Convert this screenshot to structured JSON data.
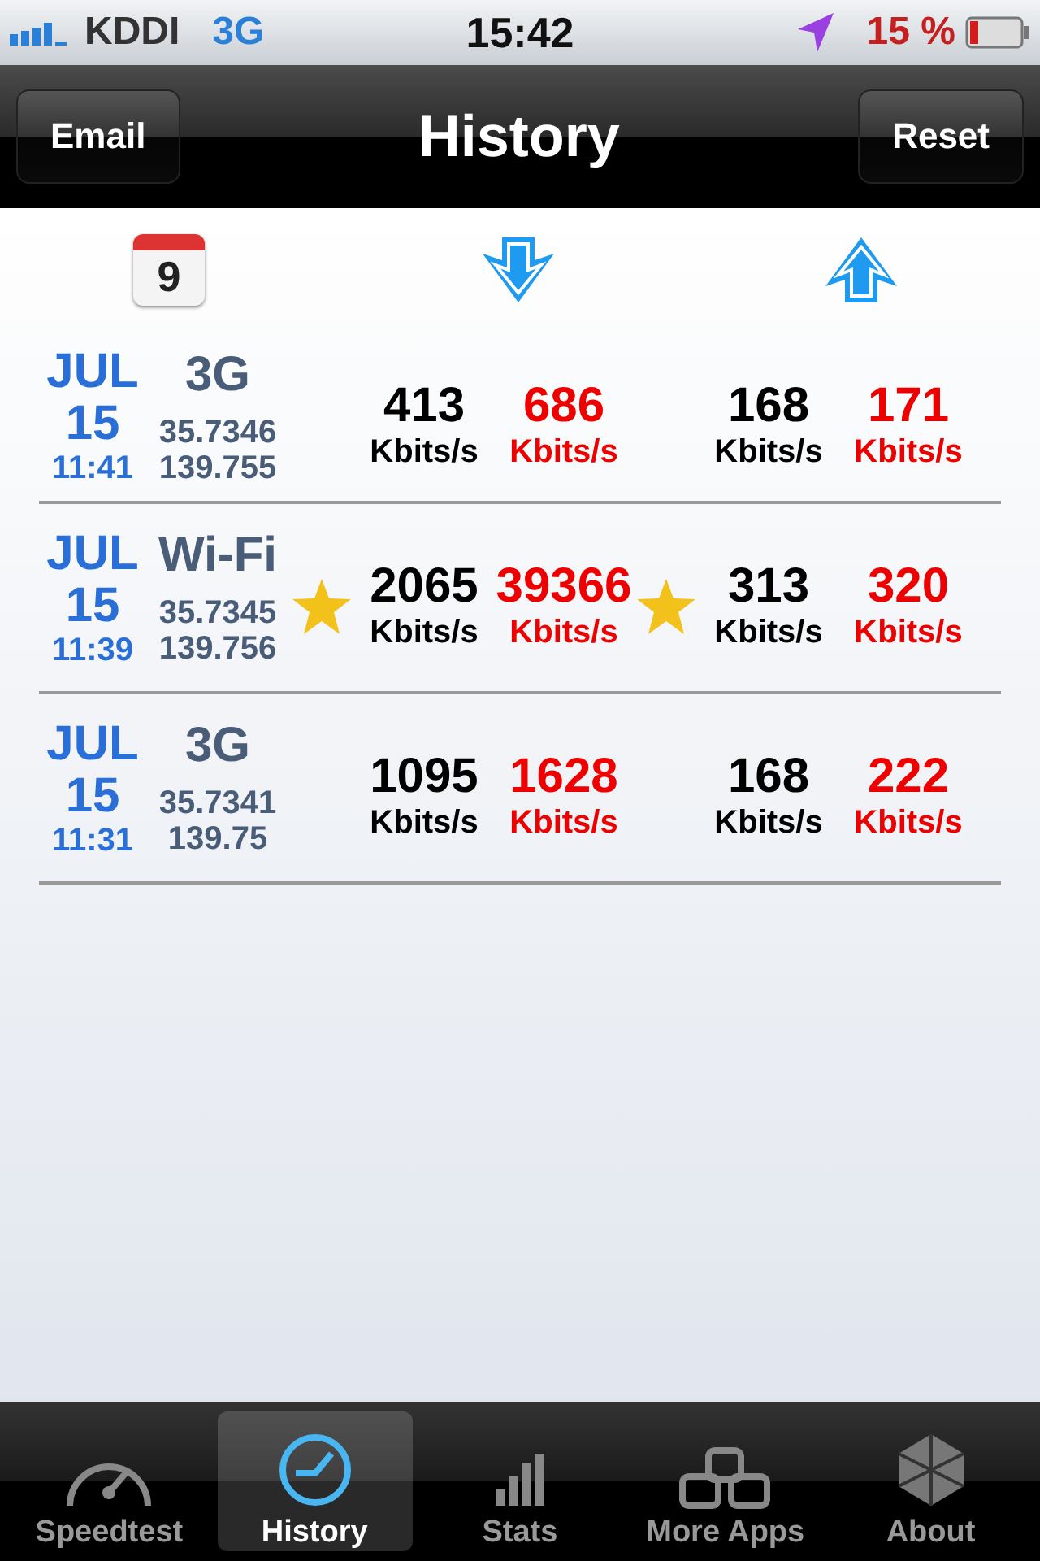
{
  "status_bar": {
    "carrier": "KDDI",
    "network": "3G",
    "time": "15:42",
    "battery": "15 %"
  },
  "nav_bar": {
    "left_button": "Email",
    "title": "History",
    "right_button": "Reset"
  },
  "header": {
    "calendar_day": "9"
  },
  "rows": [
    {
      "month": "JUL",
      "day": "15",
      "time": "11:41",
      "network": "3G",
      "latitude": "35.7346",
      "longitude": "139.755",
      "download_star": false,
      "upload_star": false,
      "download": [
        {
          "kind": "avg",
          "value": "413",
          "unit": "Kbits/s"
        },
        {
          "kind": "max",
          "value": "686",
          "unit": "Kbits/s"
        }
      ],
      "upload": [
        {
          "kind": "avg",
          "value": "168",
          "unit": "Kbits/s"
        },
        {
          "kind": "max",
          "value": "171",
          "unit": "Kbits/s"
        }
      ]
    },
    {
      "month": "JUL",
      "day": "15",
      "time": "11:39",
      "network": "Wi-Fi",
      "latitude": "35.7345",
      "longitude": "139.756",
      "download_star": true,
      "upload_star": true,
      "download": [
        {
          "kind": "avg",
          "value": "2065",
          "unit": "Kbits/s"
        },
        {
          "kind": "max",
          "value": "39366",
          "unit": "Kbits/s"
        }
      ],
      "upload": [
        {
          "kind": "avg",
          "value": "313",
          "unit": "Kbits/s"
        },
        {
          "kind": "max",
          "value": "320",
          "unit": "Kbits/s"
        }
      ]
    },
    {
      "month": "JUL",
      "day": "15",
      "time": "11:31",
      "network": "3G",
      "latitude": "35.7341",
      "longitude": "139.75",
      "download_star": false,
      "upload_star": false,
      "download": [
        {
          "kind": "avg",
          "value": "1095",
          "unit": "Kbits/s"
        },
        {
          "kind": "max",
          "value": "1628",
          "unit": "Kbits/s"
        }
      ],
      "upload": [
        {
          "kind": "avg",
          "value": "168",
          "unit": "Kbits/s"
        },
        {
          "kind": "max",
          "value": "222",
          "unit": "Kbits/s"
        }
      ]
    }
  ],
  "tab_bar": [
    {
      "label": "Speedtest",
      "kind": "gauge",
      "selected": false
    },
    {
      "label": "History",
      "kind": "clock",
      "selected": true
    },
    {
      "label": "Stats",
      "kind": "bars",
      "selected": false
    },
    {
      "label": "More Apps",
      "kind": "boxes",
      "selected": false
    },
    {
      "label": "About",
      "kind": "gem",
      "selected": false
    }
  ]
}
